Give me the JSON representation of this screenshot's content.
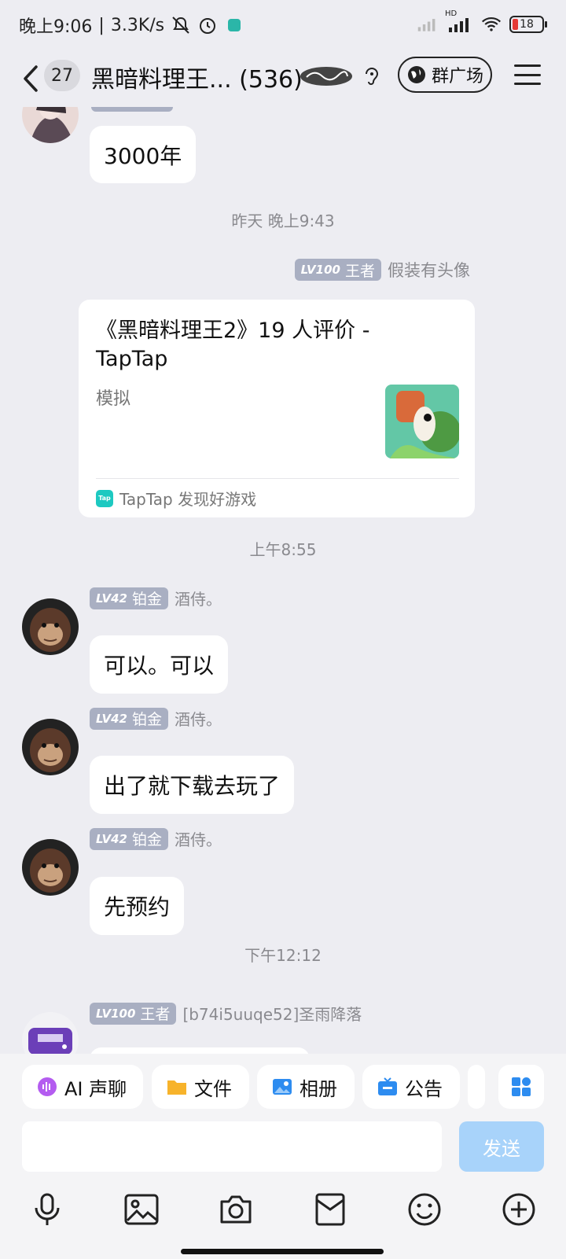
{
  "status_bar": {
    "time": "晚上9:06",
    "speed": "3.3K/s",
    "network": "HD",
    "battery": "18"
  },
  "header": {
    "unread_count": "27",
    "title": "黑暗料理王...",
    "member_count": "(536)",
    "square_label": "群广场"
  },
  "messages": {
    "m0": {
      "text": "3000年"
    },
    "ts1": "昨天 晚上9:43",
    "share": {
      "level": "LV100",
      "rank": "王者",
      "sender": "假装有头像",
      "title": "《黑暗料理王2》19 人评价 - TapTap",
      "subtitle": "模拟",
      "source_logo": "Tap",
      "source": "TapTap 发现好游戏"
    },
    "ts2": "上午8:55",
    "m1": {
      "level": "LV42",
      "rank": "铂金",
      "sender": "酒侍。",
      "text": "可以。可以"
    },
    "m2": {
      "level": "LV42",
      "rank": "铂金",
      "sender": "酒侍。",
      "text": "出了就下载去玩了"
    },
    "m3": {
      "level": "LV42",
      "rank": "铂金",
      "sender": "酒侍。",
      "text": "先预约"
    },
    "ts3": "下午12:12",
    "m4": {
      "level": "LV100",
      "rank": "王者",
      "sender": "[b74i5uuqe52]圣雨降落"
    }
  },
  "quick_actions": {
    "ai_voice": "AI 声聊",
    "files": "文件",
    "album": "相册",
    "notice": "公告"
  },
  "input": {
    "value": "",
    "send_label": "发送"
  },
  "colors": {
    "accent": "#A8D3FA",
    "badge": "#A9AFC2",
    "background": "#EDEDF2"
  }
}
